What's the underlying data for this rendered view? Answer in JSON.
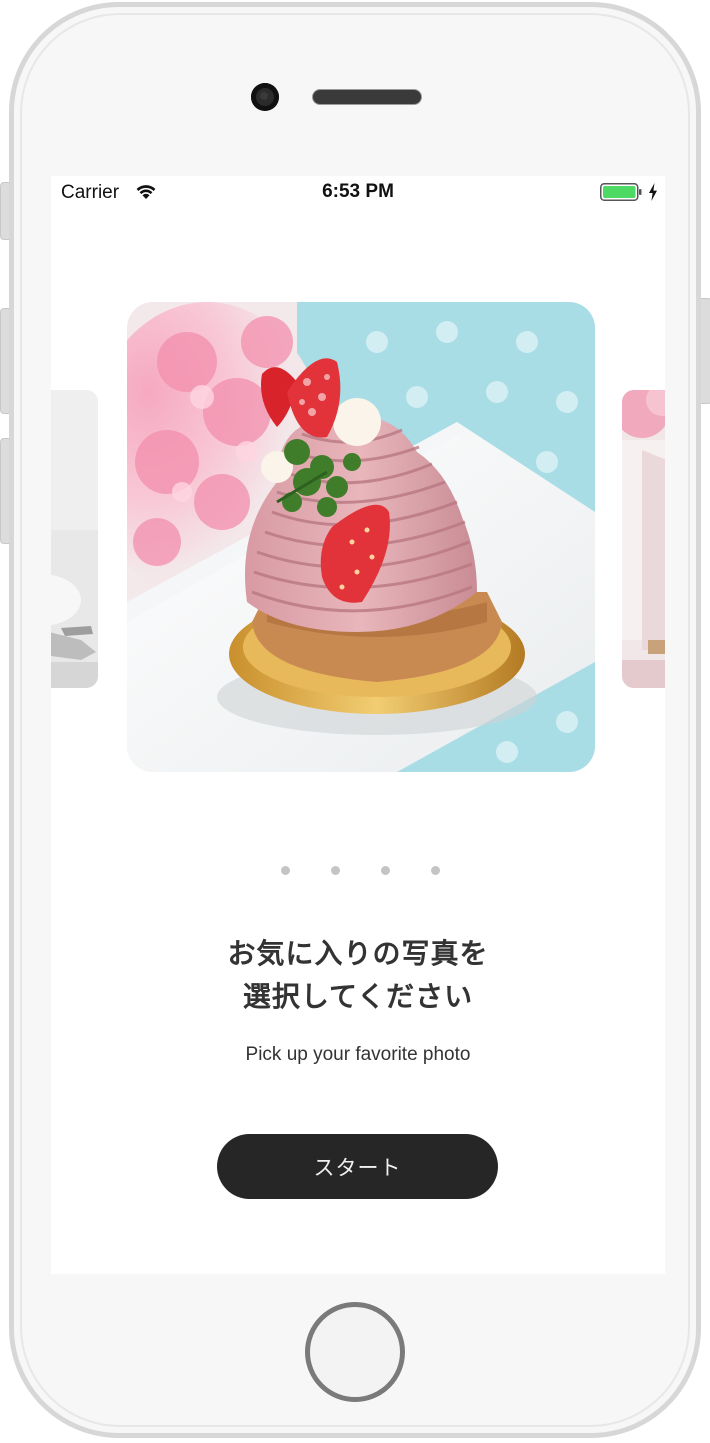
{
  "status_bar": {
    "carrier": "Carrier",
    "time": "6:53 PM",
    "wifi_icon": "wifi-icon",
    "battery_icon": "battery-full-icon",
    "charging_icon": "charging-bolt-icon",
    "battery_color": "#4cd964"
  },
  "carousel": {
    "photos": [
      "pink mont blanc cake with strawberries",
      "dessert photo",
      "dessert photo"
    ],
    "page_count": 4
  },
  "headline": {
    "line1": "お気に入りの写真を",
    "line2": "選択してください"
  },
  "subtitle": "Pick up your favorite photo",
  "start_button": {
    "label": "スタート",
    "color": "#262626"
  }
}
